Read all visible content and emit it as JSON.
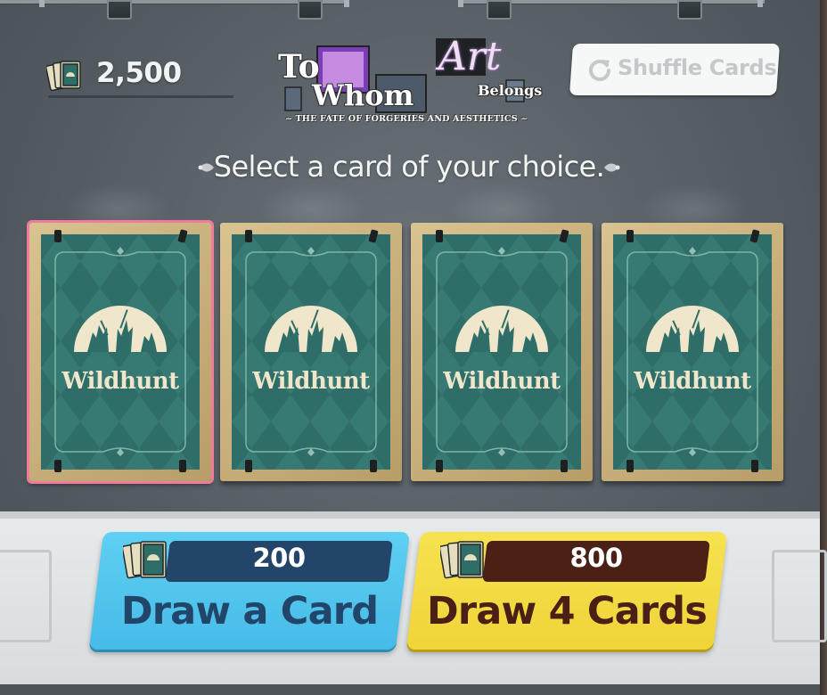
{
  "currency": {
    "amount": "2,500",
    "icon": "card-stack-icon"
  },
  "logo": {
    "line_to": "To",
    "line_whom": "Whom",
    "line_art": "Art",
    "line_belongs": "Belongs",
    "subtitle": "~ THE FATE OF FORGERIES AND AESTHETICS ~"
  },
  "shuffle": {
    "label": "Shuffle Cards",
    "icon": "refresh-icon",
    "enabled": false
  },
  "instruction": "Select a card of your choice.",
  "cards": [
    {
      "title": "Wildhunt",
      "selected": true
    },
    {
      "title": "Wildhunt",
      "selected": false
    },
    {
      "title": "Wildhunt",
      "selected": false
    },
    {
      "title": "Wildhunt",
      "selected": false
    }
  ],
  "draw_one": {
    "cost": "200",
    "label": "Draw a Card",
    "color": "#52c6ee"
  },
  "draw_four": {
    "cost": "800",
    "label": "Draw 4 Cards",
    "color": "#f3dc44"
  }
}
